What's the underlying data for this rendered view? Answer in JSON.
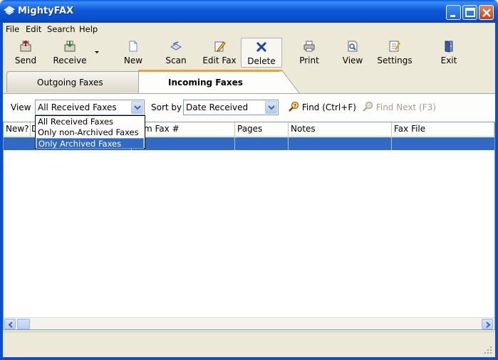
{
  "window": {
    "title": "MightyFAX"
  },
  "menu": [
    "File",
    "Edit",
    "Search",
    "Help"
  ],
  "toolbar": [
    {
      "label": "Send",
      "icon": "send-fax-icon"
    },
    {
      "label": "Receive",
      "icon": "receive-fax-icon"
    },
    {
      "label": "New",
      "icon": "new-document-icon"
    },
    {
      "label": "Scan",
      "icon": "scanner-icon"
    },
    {
      "label": "Edit Fax",
      "icon": "edit-pencil-icon"
    },
    {
      "label": "Delete",
      "icon": "delete-x-icon"
    },
    {
      "label": "Print",
      "icon": "printer-icon"
    },
    {
      "label": "View",
      "icon": "view-document-icon"
    },
    {
      "label": "Settings",
      "icon": "settings-icon"
    },
    {
      "label": "Exit",
      "icon": "exit-door-icon"
    }
  ],
  "tabs": [
    {
      "label": "Outgoing Faxes",
      "active": false
    },
    {
      "label": "Incoming Faxes",
      "active": true
    }
  ],
  "filter": {
    "view_label": "View",
    "view_value": "All Received Faxes",
    "sort_label": "Sort by",
    "sort_value": "Date Received",
    "find_label": "Find (Ctrl+F)",
    "find_next_label": "Find Next (F3)"
  },
  "view_options": [
    "All Received Faxes",
    "Only non-Archived Faxes",
    "Only Archived Faxes"
  ],
  "view_options_highlighted": "Only Archived Faxes",
  "grid": {
    "columns": [
      "New?",
      "D",
      "",
      "m Fax #",
      "Pages",
      "Notes",
      "Fax File"
    ]
  },
  "colors": {
    "selection": "#316ac5",
    "titlebar": "#0a4fcc",
    "tab_accent": "#f0a030"
  }
}
